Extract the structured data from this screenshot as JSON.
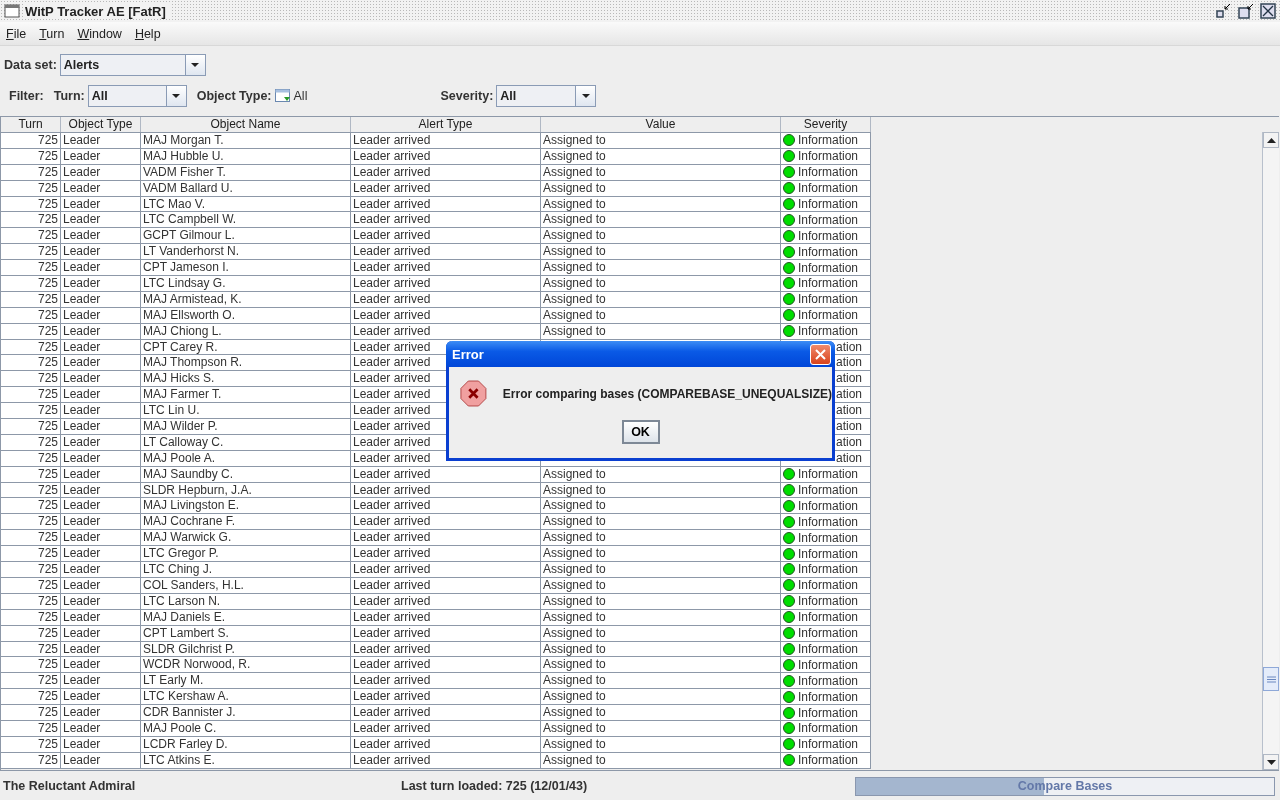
{
  "window": {
    "title": "WitP Tracker AE [FatR]"
  },
  "menu": [
    "File",
    "Turn",
    "Window",
    "Help"
  ],
  "data_set": {
    "label": "Data set:",
    "value": "Alerts"
  },
  "filter": {
    "label": "Filter:",
    "turn": {
      "label": "Turn:",
      "value": "All"
    },
    "object_type": {
      "label": "Object Type:",
      "value": "All"
    },
    "severity": {
      "label": "Severity:",
      "value": "All"
    }
  },
  "table": {
    "columns": [
      "Turn",
      "Object Type",
      "Object Name",
      "Alert Type",
      "Value",
      "Severity"
    ],
    "rows": [
      {
        "kind": "full",
        "turn": "725",
        "object_type": "Leader",
        "name": "MAJ Morgan T.",
        "alert_type": "Leader arrived",
        "value": "Assigned to",
        "severity": "Information"
      },
      {
        "kind": "full",
        "turn": "725",
        "object_type": "Leader",
        "name": "MAJ Hubble U.",
        "alert_type": "Leader arrived",
        "value": "Assigned to",
        "severity": "Information"
      },
      {
        "kind": "full",
        "turn": "725",
        "object_type": "Leader",
        "name": "VADM Fisher T.",
        "alert_type": "Leader arrived",
        "value": "Assigned to",
        "severity": "Information"
      },
      {
        "kind": "full",
        "turn": "725",
        "object_type": "Leader",
        "name": "VADM Ballard U.",
        "alert_type": "Leader arrived",
        "value": "Assigned to",
        "severity": "Information"
      },
      {
        "kind": "full",
        "turn": "725",
        "object_type": "Leader",
        "name": "LTC Mao V.",
        "alert_type": "Leader arrived",
        "value": "Assigned to",
        "severity": "Information"
      },
      {
        "kind": "full",
        "turn": "725",
        "object_type": "Leader",
        "name": "LTC Campbell W.",
        "alert_type": "Leader arrived",
        "value": "Assigned to",
        "severity": "Information"
      },
      {
        "kind": "full",
        "turn": "725",
        "object_type": "Leader",
        "name": "GCPT Gilmour L.",
        "alert_type": "Leader arrived",
        "value": "Assigned to",
        "severity": "Information"
      },
      {
        "kind": "full",
        "turn": "725",
        "object_type": "Leader",
        "name": "LT Vanderhorst N.",
        "alert_type": "Leader arrived",
        "value": "Assigned to",
        "severity": "Information"
      },
      {
        "kind": "full",
        "turn": "725",
        "object_type": "Leader",
        "name": "CPT Jameson I.",
        "alert_type": "Leader arrived",
        "value": "Assigned to",
        "severity": "Information"
      },
      {
        "kind": "full",
        "turn": "725",
        "object_type": "Leader",
        "name": "LTC Lindsay G.",
        "alert_type": "Leader arrived",
        "value": "Assigned to",
        "severity": "Information"
      },
      {
        "kind": "full",
        "turn": "725",
        "object_type": "Leader",
        "name": "MAJ Armistead, K.",
        "alert_type": "Leader arrived",
        "value": "Assigned to",
        "severity": "Information"
      },
      {
        "kind": "full",
        "turn": "725",
        "object_type": "Leader",
        "name": "MAJ Ellsworth O.",
        "alert_type": "Leader arrived",
        "value": "Assigned to",
        "severity": "Information"
      },
      {
        "kind": "full",
        "turn": "725",
        "object_type": "Leader",
        "name": "MAJ Chiong L.",
        "alert_type": "Leader arrived",
        "value": "Assigned to",
        "severity": "Information"
      },
      {
        "kind": "covered",
        "turn": "725",
        "object_type": "Leader",
        "name": "CPT Carey R.",
        "alert_type": "Leader arrived",
        "severity": "ation"
      },
      {
        "kind": "covered",
        "turn": "725",
        "object_type": "Leader",
        "name": "MAJ Thompson R.",
        "alert_type": "Leader arrived",
        "severity": "ation"
      },
      {
        "kind": "covered",
        "turn": "725",
        "object_type": "Leader",
        "name": "MAJ Hicks S.",
        "alert_type": "Leader arrived",
        "severity": "ation"
      },
      {
        "kind": "covered",
        "turn": "725",
        "object_type": "Leader",
        "name": "MAJ Farmer T.",
        "alert_type": "Leader arrived",
        "severity": "ation"
      },
      {
        "kind": "covered",
        "turn": "725",
        "object_type": "Leader",
        "name": "LTC Lin U.",
        "alert_type": "Leader arrived",
        "severity": "ation"
      },
      {
        "kind": "covered",
        "turn": "725",
        "object_type": "Leader",
        "name": "MAJ Wilder P.",
        "alert_type": "Leader arrived",
        "severity": "ation"
      },
      {
        "kind": "covered",
        "turn": "725",
        "object_type": "Leader",
        "name": "LT Calloway C.",
        "alert_type": "Leader arrived",
        "severity": "ation"
      },
      {
        "kind": "covered",
        "turn": "725",
        "object_type": "Leader",
        "name": "MAJ Poole A.",
        "alert_type": "Leader arrived",
        "severity": "ation"
      },
      {
        "kind": "full",
        "turn": "725",
        "object_type": "Leader",
        "name": "MAJ Saundby C.",
        "alert_type": "Leader arrived",
        "value": "Assigned to",
        "severity": "Information"
      },
      {
        "kind": "full",
        "turn": "725",
        "object_type": "Leader",
        "name": "SLDR Hepburn, J.A.",
        "alert_type": "Leader arrived",
        "value": "Assigned to",
        "severity": "Information"
      },
      {
        "kind": "full",
        "turn": "725",
        "object_type": "Leader",
        "name": "MAJ Livingston E.",
        "alert_type": "Leader arrived",
        "value": "Assigned to",
        "severity": "Information"
      },
      {
        "kind": "full",
        "turn": "725",
        "object_type": "Leader",
        "name": "MAJ Cochrane F.",
        "alert_type": "Leader arrived",
        "value": "Assigned to",
        "severity": "Information"
      },
      {
        "kind": "full",
        "turn": "725",
        "object_type": "Leader",
        "name": "MAJ Warwick G.",
        "alert_type": "Leader arrived",
        "value": "Assigned to",
        "severity": "Information"
      },
      {
        "kind": "full",
        "turn": "725",
        "object_type": "Leader",
        "name": "LTC Gregor P.",
        "alert_type": "Leader arrived",
        "value": "Assigned to",
        "severity": "Information"
      },
      {
        "kind": "full",
        "turn": "725",
        "object_type": "Leader",
        "name": "LTC Ching J.",
        "alert_type": "Leader arrived",
        "value": "Assigned to",
        "severity": "Information"
      },
      {
        "kind": "full",
        "turn": "725",
        "object_type": "Leader",
        "name": "COL Sanders, H.L.",
        "alert_type": "Leader arrived",
        "value": "Assigned to",
        "severity": "Information"
      },
      {
        "kind": "full",
        "turn": "725",
        "object_type": "Leader",
        "name": "LTC Larson N.",
        "alert_type": "Leader arrived",
        "value": "Assigned to",
        "severity": "Information"
      },
      {
        "kind": "full",
        "turn": "725",
        "object_type": "Leader",
        "name": "MAJ Daniels E.",
        "alert_type": "Leader arrived",
        "value": "Assigned to",
        "severity": "Information"
      },
      {
        "kind": "full",
        "turn": "725",
        "object_type": "Leader",
        "name": "CPT Lambert S.",
        "alert_type": "Leader arrived",
        "value": "Assigned to",
        "severity": "Information"
      },
      {
        "kind": "full",
        "turn": "725",
        "object_type": "Leader",
        "name": "SLDR Gilchrist P.",
        "alert_type": "Leader arrived",
        "value": "Assigned to",
        "severity": "Information"
      },
      {
        "kind": "full",
        "turn": "725",
        "object_type": "Leader",
        "name": "WCDR Norwood, R.",
        "alert_type": "Leader arrived",
        "value": "Assigned to",
        "severity": "Information"
      },
      {
        "kind": "full",
        "turn": "725",
        "object_type": "Leader",
        "name": "LT Early M.",
        "alert_type": "Leader arrived",
        "value": "Assigned to",
        "severity": "Information"
      },
      {
        "kind": "full",
        "turn": "725",
        "object_type": "Leader",
        "name": "LTC Kershaw A.",
        "alert_type": "Leader arrived",
        "value": "Assigned to",
        "severity": "Information"
      },
      {
        "kind": "full",
        "turn": "725",
        "object_type": "Leader",
        "name": "CDR Bannister J.",
        "alert_type": "Leader arrived",
        "value": "Assigned to",
        "severity": "Information"
      },
      {
        "kind": "full",
        "turn": "725",
        "object_type": "Leader",
        "name": "MAJ Poole C.",
        "alert_type": "Leader arrived",
        "value": "Assigned to",
        "severity": "Information"
      },
      {
        "kind": "full",
        "turn": "725",
        "object_type": "Leader",
        "name": "LCDR Farley D.",
        "alert_type": "Leader arrived",
        "value": "Assigned to",
        "severity": "Information"
      },
      {
        "kind": "full",
        "turn": "725",
        "object_type": "Leader",
        "name": "LTC Atkins E.",
        "alert_type": "Leader arrived",
        "value": "Assigned to",
        "severity": "Information"
      }
    ]
  },
  "dialog": {
    "title": "Error",
    "message": "Error comparing bases (COMPAREBASE_UNEQUALSIZE)",
    "button": "OK"
  },
  "status_bar": {
    "left": "The Reluctant Admiral",
    "center": "Last turn loaded: 725 (12/01/43)",
    "progress": {
      "label": "Compare Bases",
      "level": 0.45
    }
  }
}
